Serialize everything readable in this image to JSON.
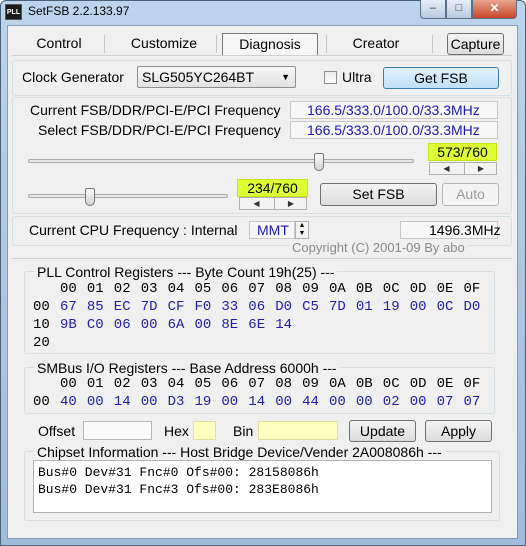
{
  "window": {
    "title": "SetFSB 2.2.133.97",
    "app_icon_text": "PLL",
    "min_glyph": "–",
    "max_glyph": "□",
    "close_glyph": "✕"
  },
  "tabs": [
    {
      "label": "Control",
      "active": false
    },
    {
      "label": "Customize",
      "active": false
    },
    {
      "label": "Diagnosis",
      "active": true
    },
    {
      "label": "Creator",
      "active": false
    }
  ],
  "capture_label": "Capture",
  "clock": {
    "label": "Clock Generator",
    "selected": "SLG505YC264BT",
    "ultra_label": "Ultra",
    "ultra_checked": false,
    "get_fsb_label": "Get FSB"
  },
  "frequency": {
    "current_label": "Current FSB/DDR/PCI-E/PCI Frequency",
    "current_value": "166.5/333.0/100.0/33.3MHz",
    "select_label": "Select FSB/DDR/PCI-E/PCI Frequency",
    "select_value": "166.5/333.0/100.0/33.3MHz"
  },
  "slider1": {
    "value_text": "573/760",
    "position": 573,
    "max": 760
  },
  "slider2": {
    "value_text": "234/760",
    "position": 234,
    "max": 760
  },
  "set_fsb_label": "Set FSB",
  "auto_label": "Auto",
  "cpu": {
    "label": "Current CPU Frequency : Internal",
    "mode": "MMT",
    "value": "1496.3MHz"
  },
  "copyright": "Copyright (C) 2001-09 By abo",
  "pll": {
    "header": "PLL Control Registers  --- Byte Count 19h(25) ---",
    "columns": [
      "00",
      "01",
      "02",
      "03",
      "04",
      "05",
      "06",
      "07",
      "08",
      "09",
      "0A",
      "0B",
      "0C",
      "0D",
      "0E",
      "0F"
    ],
    "rows": [
      {
        "addr": "00",
        "bytes": [
          "67",
          "85",
          "EC",
          "7D",
          "CF",
          "F0",
          "33",
          "06",
          "D0",
          "C5",
          "7D",
          "01",
          "19",
          "00",
          "0C",
          "D0"
        ]
      },
      {
        "addr": "10",
        "bytes": [
          "9B",
          "C0",
          "06",
          "00",
          "6A",
          "00",
          "8E",
          "6E",
          "14"
        ]
      },
      {
        "addr": "20",
        "bytes": []
      }
    ]
  },
  "smbus": {
    "header": "SMBus I/O Registers  --- Base Address 6000h ---",
    "columns": [
      "00",
      "01",
      "02",
      "03",
      "04",
      "05",
      "06",
      "07",
      "08",
      "09",
      "0A",
      "0B",
      "0C",
      "0D",
      "0E",
      "0F"
    ],
    "rows": [
      {
        "addr": "00",
        "bytes": [
          "40",
          "00",
          "14",
          "00",
          "D3",
          "19",
          "00",
          "14",
          "00",
          "44",
          "00",
          "00",
          "02",
          "00",
          "07",
          "07"
        ]
      }
    ]
  },
  "edit": {
    "offset_label": "Offset",
    "hex_label": "Hex",
    "bin_label": "Bin",
    "offset_value": "",
    "hex_value": "",
    "bin_value": "",
    "update_label": "Update",
    "apply_label": "Apply"
  },
  "chipset": {
    "header": "Chipset Information  --- Host Bridge Device/Vender 2A008086h ---",
    "lines": [
      "Bus#0 Dev#31 Fnc#0 Ofs#00: 28158086h",
      "Bus#0 Dev#31 Fnc#3 Ofs#00: 283E8086h"
    ]
  }
}
